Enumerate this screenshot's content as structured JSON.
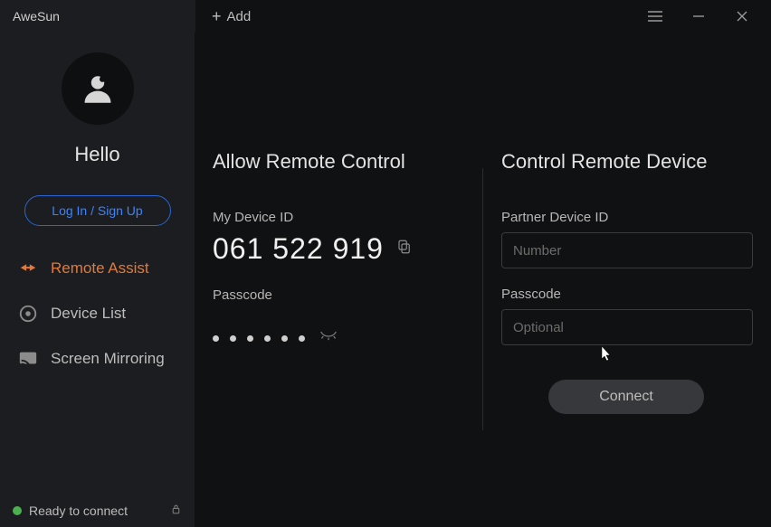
{
  "app": {
    "name": "AweSun"
  },
  "titlebar": {
    "add_label": "Add"
  },
  "sidebar": {
    "greeting": "Hello",
    "login_label": "Log In / Sign Up",
    "nav": [
      {
        "key": "remote-assist",
        "label": "Remote Assist",
        "active": true
      },
      {
        "key": "device-list",
        "label": "Device List",
        "active": false
      },
      {
        "key": "screen-mirroring",
        "label": "Screen Mirroring",
        "active": false
      }
    ],
    "status_text": "Ready to connect"
  },
  "allow_panel": {
    "title": "Allow Remote Control",
    "device_id_label": "My Device ID",
    "device_id": "061 522 919",
    "passcode_label": "Passcode",
    "passcode_masked_length": 6
  },
  "control_panel": {
    "title": "Control Remote Device",
    "partner_id_label": "Partner Device ID",
    "partner_id_placeholder": "Number",
    "partner_id_value": "",
    "passcode_label": "Passcode",
    "passcode_placeholder": "Optional",
    "passcode_value": "",
    "connect_label": "Connect"
  }
}
